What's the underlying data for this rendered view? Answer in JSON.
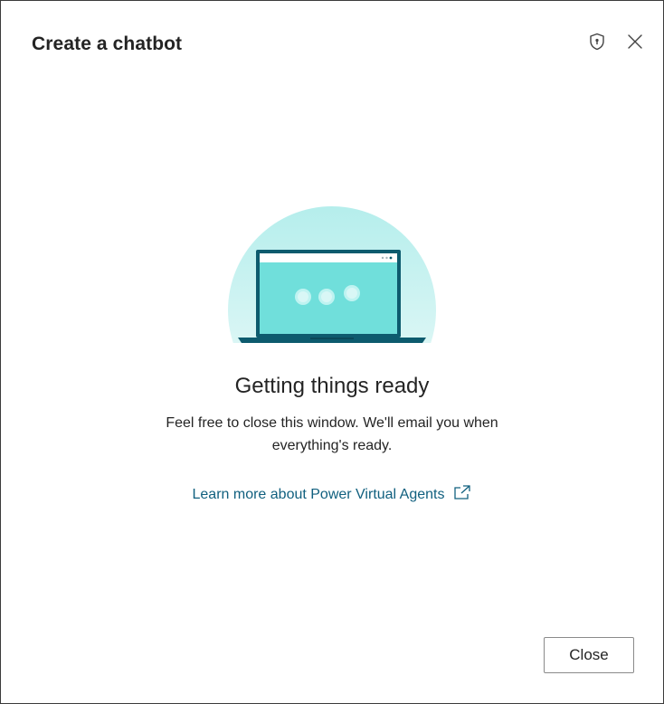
{
  "dialog": {
    "title": "Create a chatbot",
    "icons": {
      "shield": "shield-icon",
      "close": "close-icon"
    }
  },
  "status": {
    "title": "Getting things ready",
    "message": "Feel free to close this window. We'll email you when everything's ready."
  },
  "link": {
    "label": "Learn more about Power Virtual Agents",
    "icon": "external-link-icon"
  },
  "footer": {
    "close_label": "Close"
  },
  "colors": {
    "accent_teal": "#70dfdb",
    "link": "#11607f",
    "laptop_frame": "#0d5b6e",
    "halo": "#b6efec"
  }
}
